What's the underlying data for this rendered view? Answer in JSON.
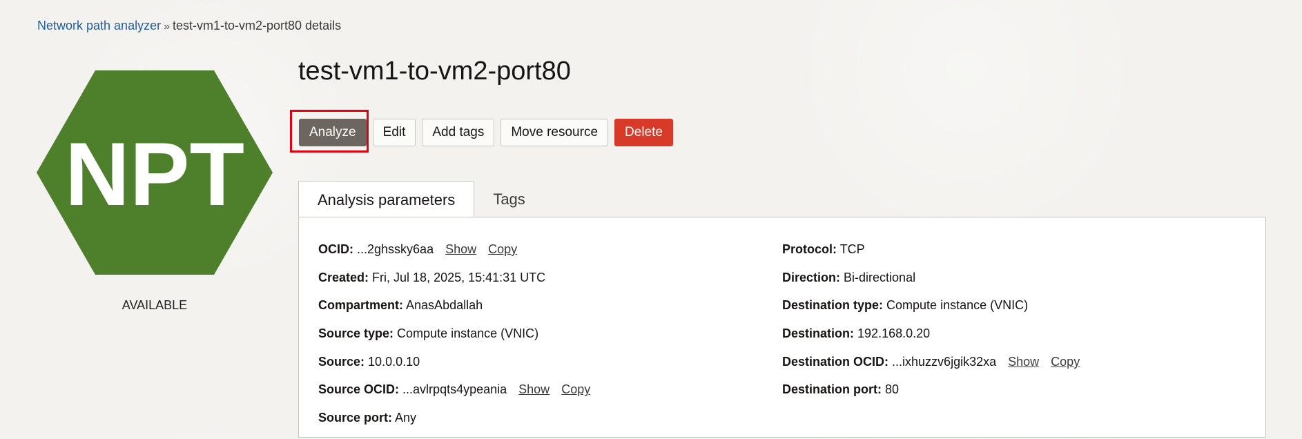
{
  "breadcrumb": {
    "parent": "Network path analyzer",
    "separator": "»",
    "current": "test-vm1-to-vm2-port80 details"
  },
  "resource_icon": {
    "text": "NPT",
    "color": "#4e7f2a",
    "status": "AVAILABLE"
  },
  "title": "test-vm1-to-vm2-port80",
  "actions": {
    "analyze": "Analyze",
    "edit": "Edit",
    "add_tags": "Add tags",
    "move_resource": "Move resource",
    "delete": "Delete"
  },
  "tabs": {
    "analysis_parameters": "Analysis parameters",
    "tags": "Tags"
  },
  "details_left": [
    {
      "key": "OCID:",
      "value": "...2ghssky6aa",
      "show": "Show",
      "copy": "Copy"
    },
    {
      "key": "Created:",
      "value": "Fri, Jul 18, 2025, 15:41:31 UTC"
    },
    {
      "key": "Compartment:",
      "value": "AnasAbdallah"
    },
    {
      "key": "Source type:",
      "value": "Compute instance (VNIC)"
    },
    {
      "key": "Source:",
      "value": "10.0.0.10"
    },
    {
      "key": "Source OCID:",
      "value": "...avlrpqts4ypeania",
      "show": "Show",
      "copy": "Copy"
    },
    {
      "key": "Source port:",
      "value": "Any"
    }
  ],
  "details_right": [
    {
      "key": "Protocol:",
      "value": "TCP"
    },
    {
      "key": "Direction:",
      "value": "Bi-directional"
    },
    {
      "key": "Destination type:",
      "value": "Compute instance (VNIC)"
    },
    {
      "key": "Destination:",
      "value": "192.168.0.20"
    },
    {
      "key": "Destination OCID:",
      "value": "...ixhuzzv6jgik32xa",
      "show": "Show",
      "copy": "Copy"
    },
    {
      "key": "Destination port:",
      "value": "80"
    }
  ],
  "colors": {
    "accent_link": "#1f5e9a",
    "primary_button": "#6c6560",
    "danger_button": "#d73a29",
    "highlight_border": "#e3000f"
  }
}
